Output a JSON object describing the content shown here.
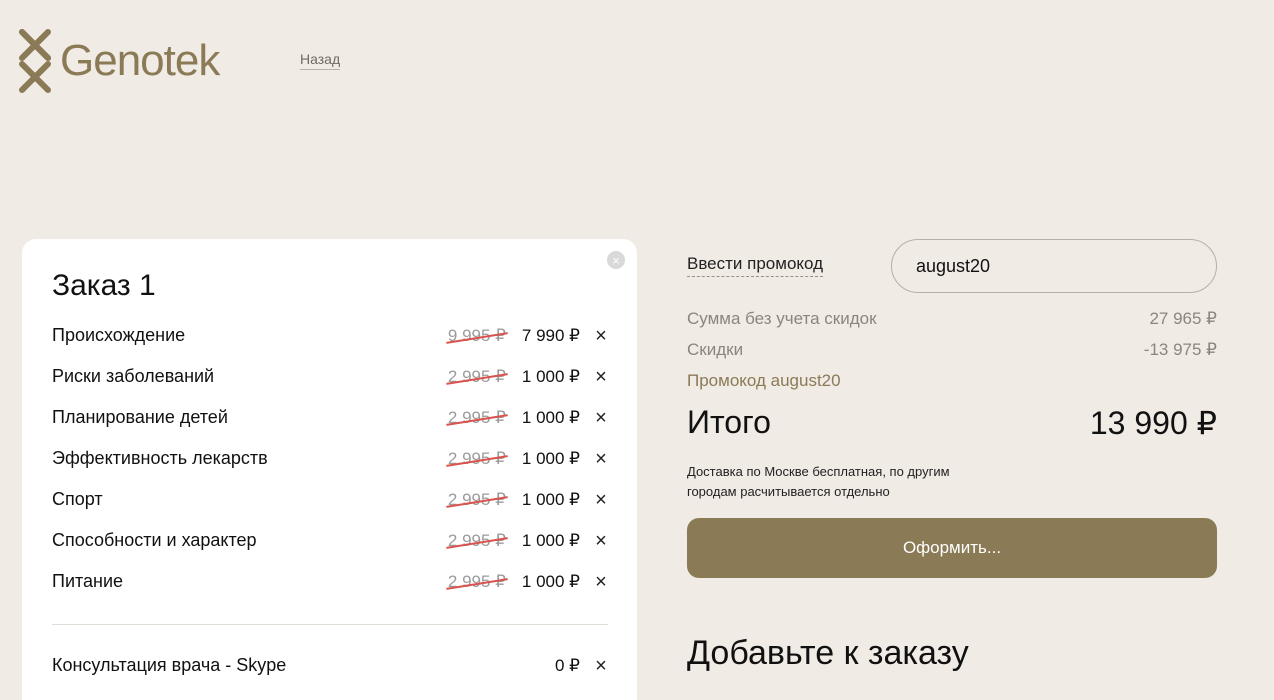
{
  "header": {
    "brand": "Genotek",
    "back_label": "Назад"
  },
  "order": {
    "title": "Заказ 1",
    "items": [
      {
        "name": "Происхождение",
        "old_price": "9 995 ₽",
        "price": "7 990 ₽"
      },
      {
        "name": "Риски заболеваний",
        "old_price": "2 995 ₽",
        "price": "1 000 ₽"
      },
      {
        "name": "Планирование детей",
        "old_price": "2 995 ₽",
        "price": "1 000 ₽"
      },
      {
        "name": "Эффективность лекарств",
        "old_price": "2 995 ₽",
        "price": "1 000 ₽"
      },
      {
        "name": "Спорт",
        "old_price": "2 995 ₽",
        "price": "1 000 ₽"
      },
      {
        "name": "Способности и характер",
        "old_price": "2 995 ₽",
        "price": "1 000 ₽"
      },
      {
        "name": "Питание",
        "old_price": "2 995 ₽",
        "price": "1 000 ₽"
      }
    ],
    "extras": [
      {
        "name": "Консультация врача - Skype",
        "price": "0 ₽"
      }
    ],
    "remove_symbol": "×"
  },
  "promo": {
    "label": "Ввести промокод",
    "value": "august20"
  },
  "summary": {
    "subtotal_label": "Сумма без учета скидок",
    "subtotal_value": "27 965 ₽",
    "discount_label": "Скидки",
    "discount_value": "-13 975 ₽",
    "promo_line": "Промокод august20",
    "total_label": "Итого",
    "total_value": "13 990 ₽",
    "delivery_note": "Доставка по Москве бесплатная, по другим городам расчитывается отдельно",
    "checkout_label": "Оформить..."
  },
  "addons": {
    "title": "Добавьте к заказу"
  },
  "colors": {
    "background": "#f1ebe6",
    "brand": "#8a7a55",
    "strike": "#d9534f"
  }
}
